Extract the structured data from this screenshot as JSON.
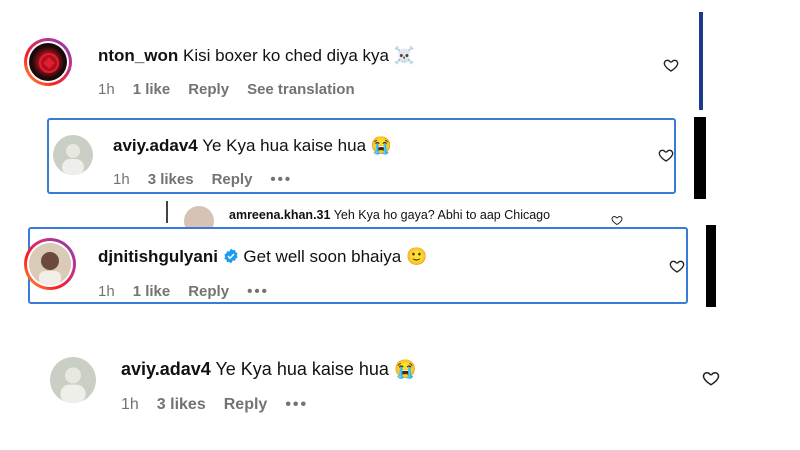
{
  "comments": [
    {
      "username": "nton_won",
      "text": "Kisi boxer ko ched diya kya",
      "emoji": "☠️",
      "time": "1h",
      "likes": "1 like",
      "reply": "Reply",
      "translation": "See translation"
    },
    {
      "username": "aviy.adav4",
      "text": "Ye Kya hua kaise hua",
      "emoji": "😭",
      "time": "1h",
      "likes": "3 likes",
      "reply": "Reply",
      "more": "•••"
    },
    {
      "username": "amreena.khan.31",
      "text": "Yeh Kya ho gaya? Abhi to aap Chicago"
    },
    {
      "username": "djnitishgulyani",
      "text": "Get well soon bhaiya",
      "emoji": "🙂",
      "time": "1h",
      "likes": "1 like",
      "reply": "Reply",
      "more": "•••"
    },
    {
      "username": "aviy.adav4",
      "text": "Ye Kya hua kaise hua",
      "emoji": "😭",
      "time": "1h",
      "likes": "3 likes",
      "reply": "Reply",
      "more": "•••"
    }
  ],
  "colors": {
    "highlight_border": "#3b7bd8",
    "verified": "#1d9bf0",
    "meta_text": "#737373"
  },
  "icons": {
    "like": "heart-outline-icon",
    "verified": "verified-badge-icon"
  }
}
